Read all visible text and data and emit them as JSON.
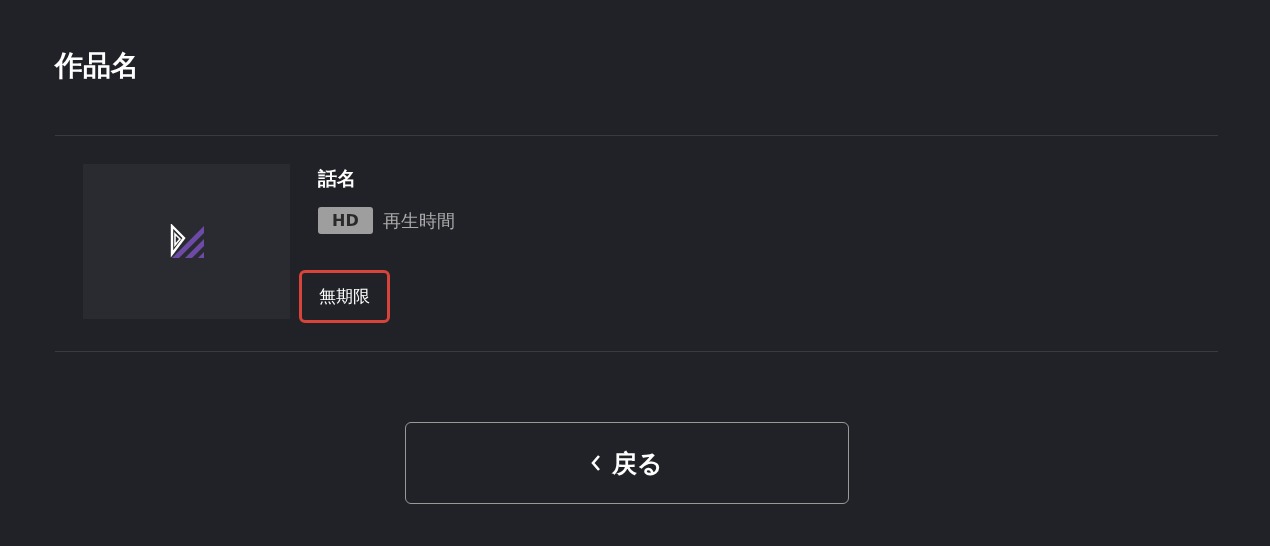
{
  "title": "作品名",
  "episodes": [
    {
      "title": "話名",
      "quality": "HD",
      "duration_label": "再生時間",
      "expiry": "無期限",
      "highlighted": true
    }
  ],
  "back_button": {
    "label": "戻る"
  }
}
